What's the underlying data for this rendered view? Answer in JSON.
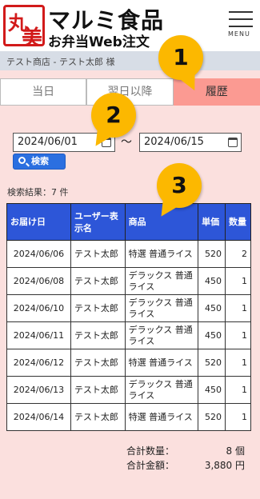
{
  "header": {
    "logo_chars": [
      "丸",
      "美"
    ],
    "brand_name": "マルミ食品",
    "brand_sub": "お弁当Web注文",
    "menu_label": "MENU"
  },
  "userbar": {
    "text": "テスト商店 - テスト太郎 様"
  },
  "tabs": [
    {
      "label": "当日",
      "active": false
    },
    {
      "label": "翌日以降",
      "active": false
    },
    {
      "label": "履歴",
      "active": true
    }
  ],
  "search": {
    "date_from": "2024/06/01",
    "date_to": "2024/06/15",
    "separator": "〜",
    "button_label": "検索"
  },
  "result_count": "検索結果：7 件",
  "table": {
    "headers": [
      "お届け日",
      "ユーザー表示名",
      "商品",
      "単価",
      "数量"
    ],
    "rows": [
      [
        "2024/06/06",
        "テスト太郎",
        "特選 普通ライス",
        "520",
        "2"
      ],
      [
        "2024/06/08",
        "テスト太郎",
        "デラックス 普通ライス",
        "450",
        "1"
      ],
      [
        "2024/06/10",
        "テスト太郎",
        "デラックス 普通ライス",
        "450",
        "1"
      ],
      [
        "2024/06/11",
        "テスト太郎",
        "デラックス 普通ライス",
        "450",
        "1"
      ],
      [
        "2024/06/12",
        "テスト太郎",
        "特選 普通ライス",
        "520",
        "1"
      ],
      [
        "2024/06/13",
        "テスト太郎",
        "デラックス 普通ライス",
        "450",
        "1"
      ],
      [
        "2024/06/14",
        "テスト太郎",
        "特選 普通ライス",
        "520",
        "1"
      ]
    ]
  },
  "totals": {
    "qty_label": "合計数量：",
    "qty_value": "8 個",
    "amount_label": "合計金額：",
    "amount_value": "3,880 円"
  },
  "badges": [
    "1",
    "2",
    "3"
  ],
  "colors": {
    "brand_red": "#d21a1a",
    "tab_active": "#fb9a92",
    "table_header": "#2d56d8",
    "search_button": "#2b6fe0",
    "badge": "#fcb800",
    "page_bg": "#fbe0de"
  }
}
